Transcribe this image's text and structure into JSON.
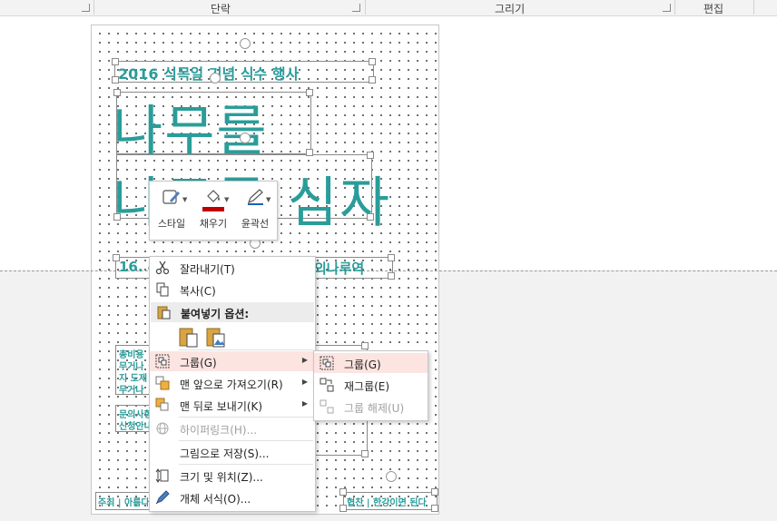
{
  "ribbon": {
    "groups": [
      "단락",
      "그리기",
      "편집"
    ]
  },
  "slide": {
    "subtitle": "2016 식목일 기념 식수 행사",
    "title_line1": "나무를",
    "title_line2": "나무를 심자",
    "date_prefix": "16. 4",
    "date_suffix": "의나루역",
    "left_text_lines": [
      "총비용",
      "무거나",
      "지 도제",
      "무거나",
      "문의사항",
      "신청안내"
    ],
    "footer_left": "주최 | 아름다",
    "footer_right": "협찬 | 한강이면 된다"
  },
  "mini_toolbar": {
    "items": [
      {
        "label": "스타일",
        "icon": "shape-style-icon"
      },
      {
        "label": "채우기",
        "icon": "fill-bucket-icon"
      },
      {
        "label": "윤곽선",
        "icon": "outline-pen-icon"
      }
    ],
    "fill_color": "#c00000",
    "outline_color": "#1f5fb4"
  },
  "context_menu": {
    "cut": "잘라내기(T)",
    "copy": "복사(C)",
    "paste_options": "붙여넣기 옵션:",
    "group": "그룹(G)",
    "bring_front": "맨 앞으로 가져오기(R)",
    "send_back": "맨 뒤로 보내기(K)",
    "hyperlink": "하이퍼링크(H)...",
    "save_picture": "그림으로 저장(S)...",
    "size_position": "크기 및 위치(Z)...",
    "format_object": "개체 서식(O)..."
  },
  "submenu": {
    "group": "그룹(G)",
    "regroup": "재그룹(E)",
    "ungroup": "그룹 해제(U)"
  },
  "colors": {
    "accent_teal": "#2a9d9a",
    "highlight": "#fce4e1"
  }
}
